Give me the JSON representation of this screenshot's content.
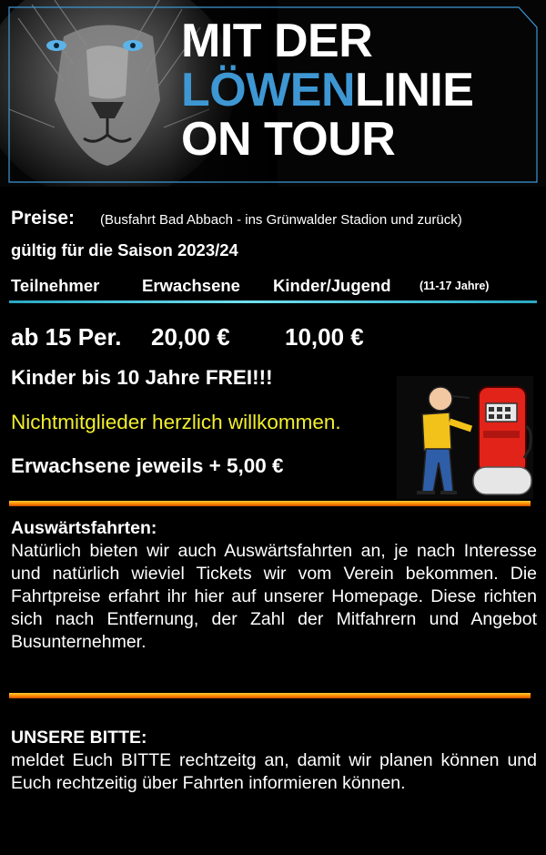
{
  "banner": {
    "headline_line1": "MIT DER",
    "headline_accent": "LÖWEN",
    "headline_line2_rest": "LINIE",
    "headline_line3": "ON TOUR"
  },
  "prices": {
    "label": "Preise:",
    "note": "(Busfahrt Bad Abbach - ins Grünwalder Stadion und zurück)",
    "season": "gültig für die Saison 2023/24",
    "columns": {
      "participants": "Teilnehmer",
      "adults": "Erwachsene",
      "kids": "Kinder/Jugend",
      "kids_age": "(11-17 Jahre)"
    },
    "row": {
      "group": "ab 15 Per.",
      "adult_price": "20,00 €",
      "kid_price": "10,00 €"
    },
    "free_note": "Kinder bis 10 Jahre FREI!!!",
    "guests_note": "Nichtmitglieder herzlich willkommen.",
    "surcharge_note": "Erwachsene jeweils + 5,00 €"
  },
  "away_trips": {
    "title": "Auswärtsfahrten:",
    "body": "Natürlich bieten wir auch Auswärtsfahrten an, je nach Interesse und natürlich wieviel Tickets wir vom Verein bekommen. Die Fahrtpreise erfahrt ihr hier auf unserer Homepage. Diese richten sich nach Entfernung, der Zahl der Mitfahrern und Angebot Busunternehmer."
  },
  "request": {
    "title": "UNSERE BITTE:",
    "body": "meldet Euch BITTE rechtzeitg an, damit wir planen können und Euch rechtzeitig über Fahrten informieren können."
  },
  "colors": {
    "accent_blue": "#3e97d3",
    "guest_yellow": "#f2ef2e",
    "rule_cyan": "#6fe0f0",
    "rule_orange": "#ff8a00"
  },
  "icons": [
    "lion-image",
    "gas-pump-cartoon-icon"
  ]
}
